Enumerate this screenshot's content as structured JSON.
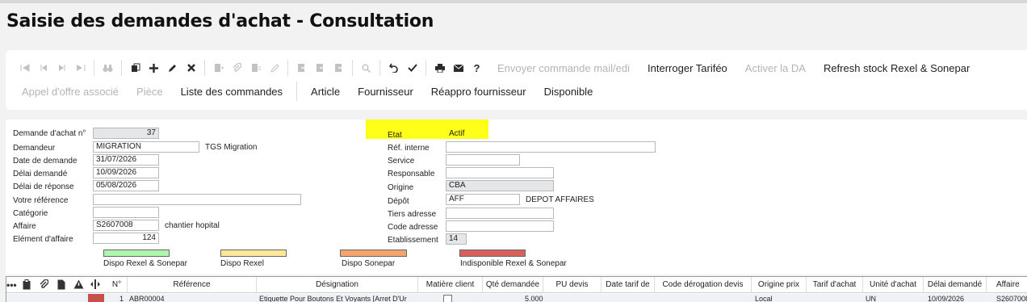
{
  "page": {
    "title": "Saisie des demandes d'achat - Consultation"
  },
  "toolbar": {
    "icons": [
      "first-icon",
      "prev-icon",
      "next-icon",
      "last-icon",
      "binoculars-icon",
      "duplicate-icon",
      "plus-icon",
      "edit-icon",
      "delete-icon",
      "doc-add-icon",
      "attach-icon",
      "doc-link-icon",
      "doc-edit-icon",
      "export-1-icon",
      "export-2-icon",
      "export-3-icon",
      "search-icon",
      "undo-icon",
      "check-icon",
      "print-icon",
      "mail-icon",
      "help-icon"
    ],
    "row1": [
      "Envoyer commande mail/edi",
      "Interroger Tariféo",
      "Activer la DA",
      "Refresh stock Rexel & Sonepar"
    ],
    "row2": [
      "Appel d'offre associé",
      "Pièce",
      "Liste des commandes",
      "Article",
      "Fournisseur",
      "Réappro fournisseur",
      "Disponible"
    ]
  },
  "form": {
    "left": [
      {
        "label": "Demande d'achat n°",
        "value": "37"
      },
      {
        "label": "Demandeur",
        "value": "MIGRATION",
        "extra": "TGS Migration"
      },
      {
        "label": "Date de demande",
        "value": "31/07/2026"
      },
      {
        "label": "Délai demandé",
        "value": "10/09/2026"
      },
      {
        "label": "Délai de réponse",
        "value": "05/08/2026"
      },
      {
        "label": "Votre référence",
        "value": ""
      },
      {
        "label": "Catégorie",
        "value": ""
      },
      {
        "label": "Affaire",
        "value": "S2607008",
        "extra": "chantier hopital"
      },
      {
        "label": "Elément d'affaire",
        "value": "124"
      }
    ],
    "right": [
      {
        "label": "Etat",
        "value": "Actif"
      },
      {
        "label": "Réf. interne",
        "value": ""
      },
      {
        "label": "Service",
        "value": ""
      },
      {
        "label": "Responsable",
        "value": ""
      },
      {
        "label": "Origine",
        "value": "CBA"
      },
      {
        "label": "Dépôt",
        "value": "AFF",
        "extra": "DEPOT AFFAIRES"
      },
      {
        "label": "Tiers adresse",
        "value": ""
      },
      {
        "label": "Code adresse",
        "value": ""
      },
      {
        "label": "Etablissement",
        "value": "14"
      }
    ],
    "legend": [
      {
        "label": "Dispo Rexel & Sonepar",
        "color": "#aef5ae"
      },
      {
        "label": "Dispo Rexel",
        "color": "#ffe79a"
      },
      {
        "label": "Dispo Sonepar",
        "color": "#f4a46c"
      },
      {
        "label": "Indisponible Rexel & Sonepar",
        "color": "#d9605a"
      }
    ]
  },
  "grid": {
    "columns": [
      "N°",
      "Référence",
      "Désignation",
      "Matière client",
      "Qté demandée",
      "PU devis",
      "Date tarif de",
      "Code dérogation devis",
      "Origine prix",
      "Tarif d'achat",
      "Unité d'achat",
      "Délai demandé",
      "Affaire"
    ],
    "row": {
      "num": "1",
      "ref": "ABR00004",
      "designation": "Etiquette Pour Boutons Et Voyants [Arret D'Ur",
      "qty": "5.000",
      "origine": "Local",
      "unite": "UN",
      "delai": "10/09/2026",
      "affaire": "S2607008"
    }
  }
}
